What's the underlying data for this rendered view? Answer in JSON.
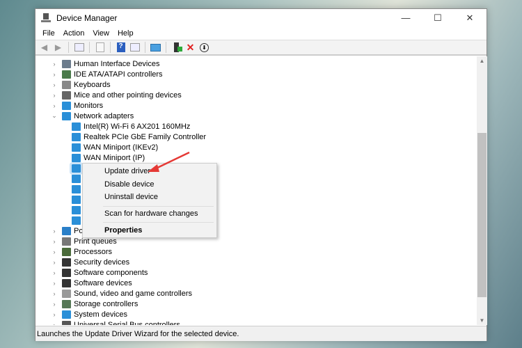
{
  "window": {
    "title": "Device Manager",
    "minimize": "—",
    "maximize": "☐",
    "close": "✕"
  },
  "menu": [
    "File",
    "Action",
    "View",
    "Help"
  ],
  "toolbar": [
    "back-icon",
    "forward-icon",
    "show-hide-console-tree-icon",
    "export-icon",
    "help-icon",
    "properties-icon",
    "scan-hardware-icon",
    "update-driver-icon",
    "uninstall-icon",
    "disable-icon"
  ],
  "tree": [
    {
      "label": "Human Interface Devices",
      "level": 0,
      "expanded": false,
      "color": "#6b7b8c"
    },
    {
      "label": "IDE ATA/ATAPI controllers",
      "level": 0,
      "expanded": false,
      "color": "#4a7a4a"
    },
    {
      "label": "Keyboards",
      "level": 0,
      "expanded": false,
      "color": "#888888"
    },
    {
      "label": "Mice and other pointing devices",
      "level": 0,
      "expanded": false,
      "color": "#666666"
    },
    {
      "label": "Monitors",
      "level": 0,
      "expanded": false,
      "color": "#2a8fd8"
    },
    {
      "label": "Network adapters",
      "level": 0,
      "expanded": true,
      "color": "#2a8fd8"
    },
    {
      "label": "Intel(R) Wi-Fi 6 AX201 160MHz",
      "level": 1,
      "color": "#2a8fd8"
    },
    {
      "label": "Realtek PCIe GbE Family Controller",
      "level": 1,
      "color": "#2a8fd8"
    },
    {
      "label": "WAN Miniport (IKEv2)",
      "level": 1,
      "color": "#2a8fd8"
    },
    {
      "label": "WAN Miniport (IP)",
      "level": 1,
      "color": "#2a8fd8"
    },
    {
      "label": "",
      "level": 1,
      "color": "#2a8fd8",
      "selected": true
    },
    {
      "label": "",
      "level": 1,
      "color": "#2a8fd8"
    },
    {
      "label": "",
      "level": 1,
      "color": "#2a8fd8"
    },
    {
      "label": "",
      "level": 1,
      "color": "#2a8fd8"
    },
    {
      "label": "",
      "level": 1,
      "color": "#2a8fd8"
    },
    {
      "label": "",
      "level": 1,
      "color": "#2a8fd8"
    },
    {
      "label": "Port",
      "level": 0,
      "expanded": false,
      "color": "#2a7fc8"
    },
    {
      "label": "Print queues",
      "level": 0,
      "expanded": false,
      "color": "#777777"
    },
    {
      "label": "Processors",
      "level": 0,
      "expanded": false,
      "color": "#4a6a3a"
    },
    {
      "label": "Security devices",
      "level": 0,
      "expanded": false,
      "color": "#333333"
    },
    {
      "label": "Software components",
      "level": 0,
      "expanded": false,
      "color": "#333333"
    },
    {
      "label": "Software devices",
      "level": 0,
      "expanded": false,
      "color": "#333333"
    },
    {
      "label": "Sound, video and game controllers",
      "level": 0,
      "expanded": false,
      "color": "#999999"
    },
    {
      "label": "Storage controllers",
      "level": 0,
      "expanded": false,
      "color": "#557755"
    },
    {
      "label": "System devices",
      "level": 0,
      "expanded": false,
      "color": "#2a8fd8"
    },
    {
      "label": "Universal Serial Bus controllers",
      "level": 0,
      "expanded": false,
      "color": "#555555"
    }
  ],
  "context_menu": {
    "items": [
      "Update driver",
      "Disable device",
      "Uninstall device",
      "Scan for hardware changes",
      "Properties"
    ]
  },
  "status": "Launches the Update Driver Wizard for the selected device.",
  "annotation_color": "#e53935"
}
